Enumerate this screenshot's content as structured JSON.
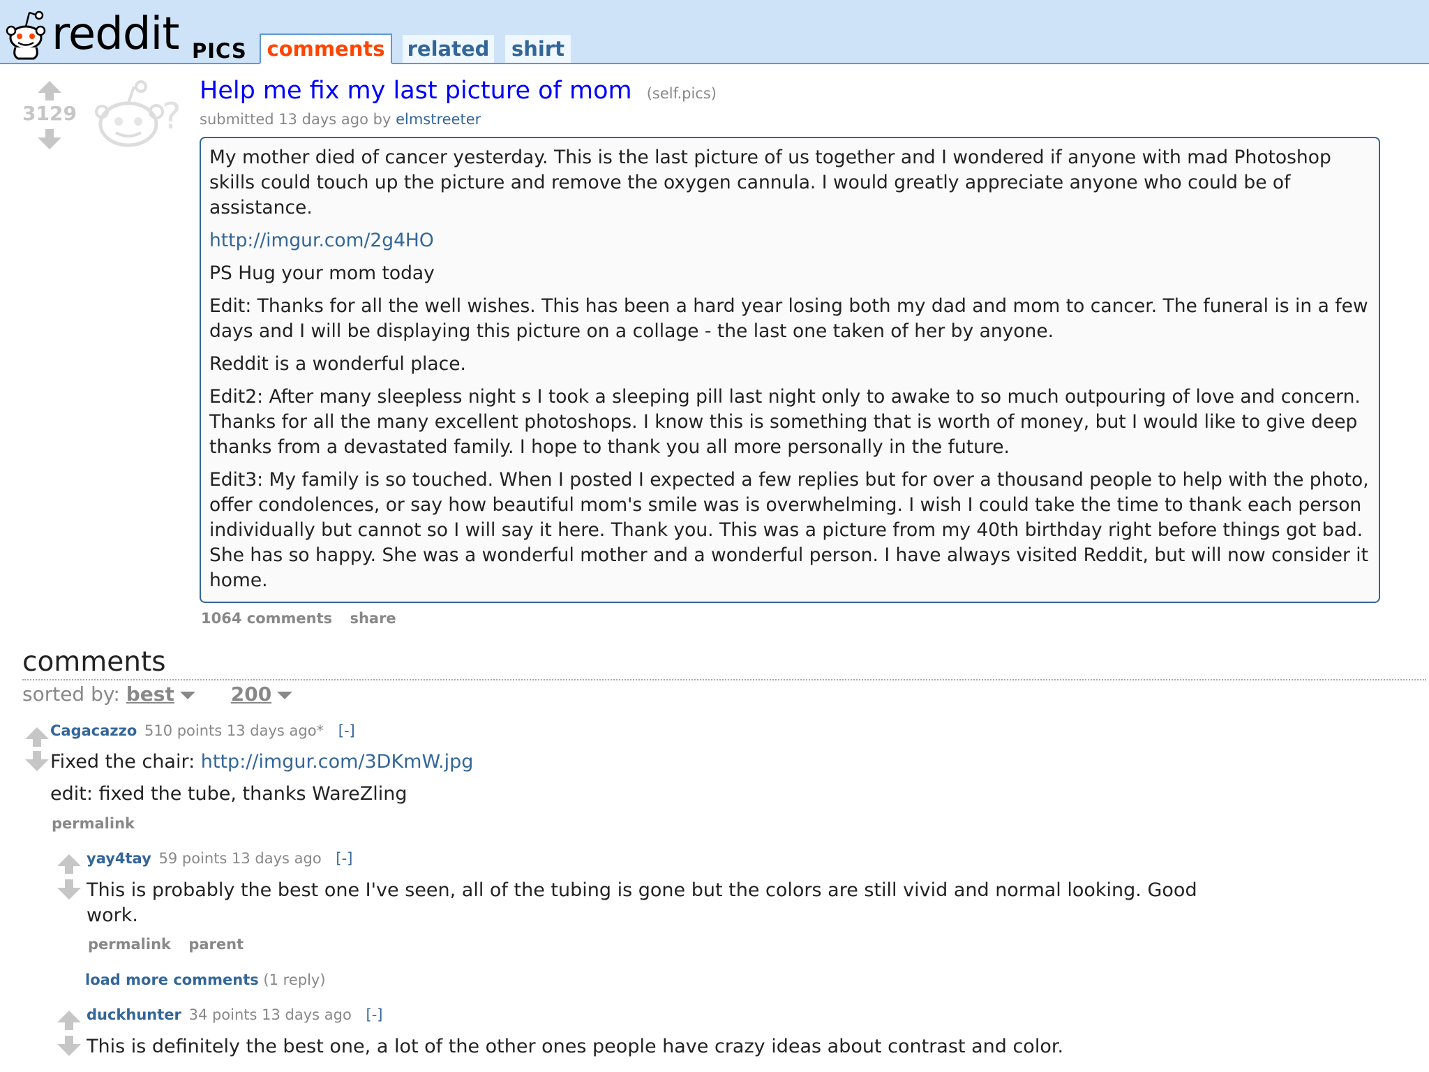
{
  "header": {
    "wordmark": "reddit",
    "subreddit": "PICS",
    "tabs": [
      {
        "label": "comments"
      },
      {
        "label": "related"
      },
      {
        "label": "shirt"
      }
    ]
  },
  "post": {
    "score": "3129",
    "title": "Help me fix my last picture of mom",
    "domain": "(self.pics)",
    "submitted": "submitted 13 days ago by",
    "author": "elmstreeter",
    "selftext": [
      "My mother died of cancer yesterday. This is the last picture of us together and I wondered if anyone with mad Photoshop skills could touch up the picture and remove the oxygen cannula. I would greatly appreciate anyone who could be of assistance.",
      "http://imgur.com/2g4HO",
      "PS Hug your mom today",
      "Edit: Thanks for all the well wishes. This has been a hard year losing both my dad and mom to cancer. The funeral is in a few days and I will be displaying this picture on a collage - the last one taken of her by anyone.",
      "Reddit is a wonderful place.",
      "Edit2: After many sleepless night s I took a sleeping pill last night only to awake to so much outpouring of love and concern. Thanks for all the many excellent photoshops. I know this is something that is worth of money, but I would like to give deep thanks from a devastated family. I hope to thank you all more personally in the future.",
      "Edit3: My family is so touched. When I posted I expected a few replies but for over a thousand people to help with the photo, offer condolences, or say how beautiful mom's smile was is overwhelming. I wish I could take the time to thank each person individually but cannot so I will say it here. Thank you. This was a picture from my 40th birthday right before things got bad. She has so happy. She was a wonderful mother and a wonderful person. I have always visited Reddit, but will now consider it home."
    ],
    "comments_link": "1064 comments",
    "share_link": "share"
  },
  "comments_section": {
    "heading": "comments",
    "sort_label": "sorted by:",
    "sort_value": "best",
    "limit_value": "200"
  },
  "comments": [
    {
      "author": "Cagacazzo",
      "meta": "510 points 13 days ago*",
      "toggle": "[-]",
      "body_prefix": "Fixed the chair:",
      "body_link": "http://imgur.com/3DKmW.jpg",
      "body_line2": "edit: fixed the tube, thanks WareZling",
      "permalink": "permalink"
    },
    {
      "author": "yay4tay",
      "meta": "59 points 13 days ago",
      "toggle": "[-]",
      "body": "This is probably the best one I've seen, all of the tubing is gone but the colors are still vivid and normal looking. Good work.",
      "permalink": "permalink",
      "parent": "parent"
    },
    {
      "load_more": "load more comments",
      "reply_count": "(1 reply)"
    },
    {
      "author": "duckhunter",
      "meta": "34 points 13 days ago",
      "toggle": "[-]",
      "body": "This is definitely the best one, a lot of the other ones people have crazy ideas about contrast and color."
    }
  ],
  "colors": {
    "header_bg": "#cee3f8",
    "link_blue": "#369",
    "title_blue": "#0000ff",
    "selected_tab": "#ff4500"
  }
}
